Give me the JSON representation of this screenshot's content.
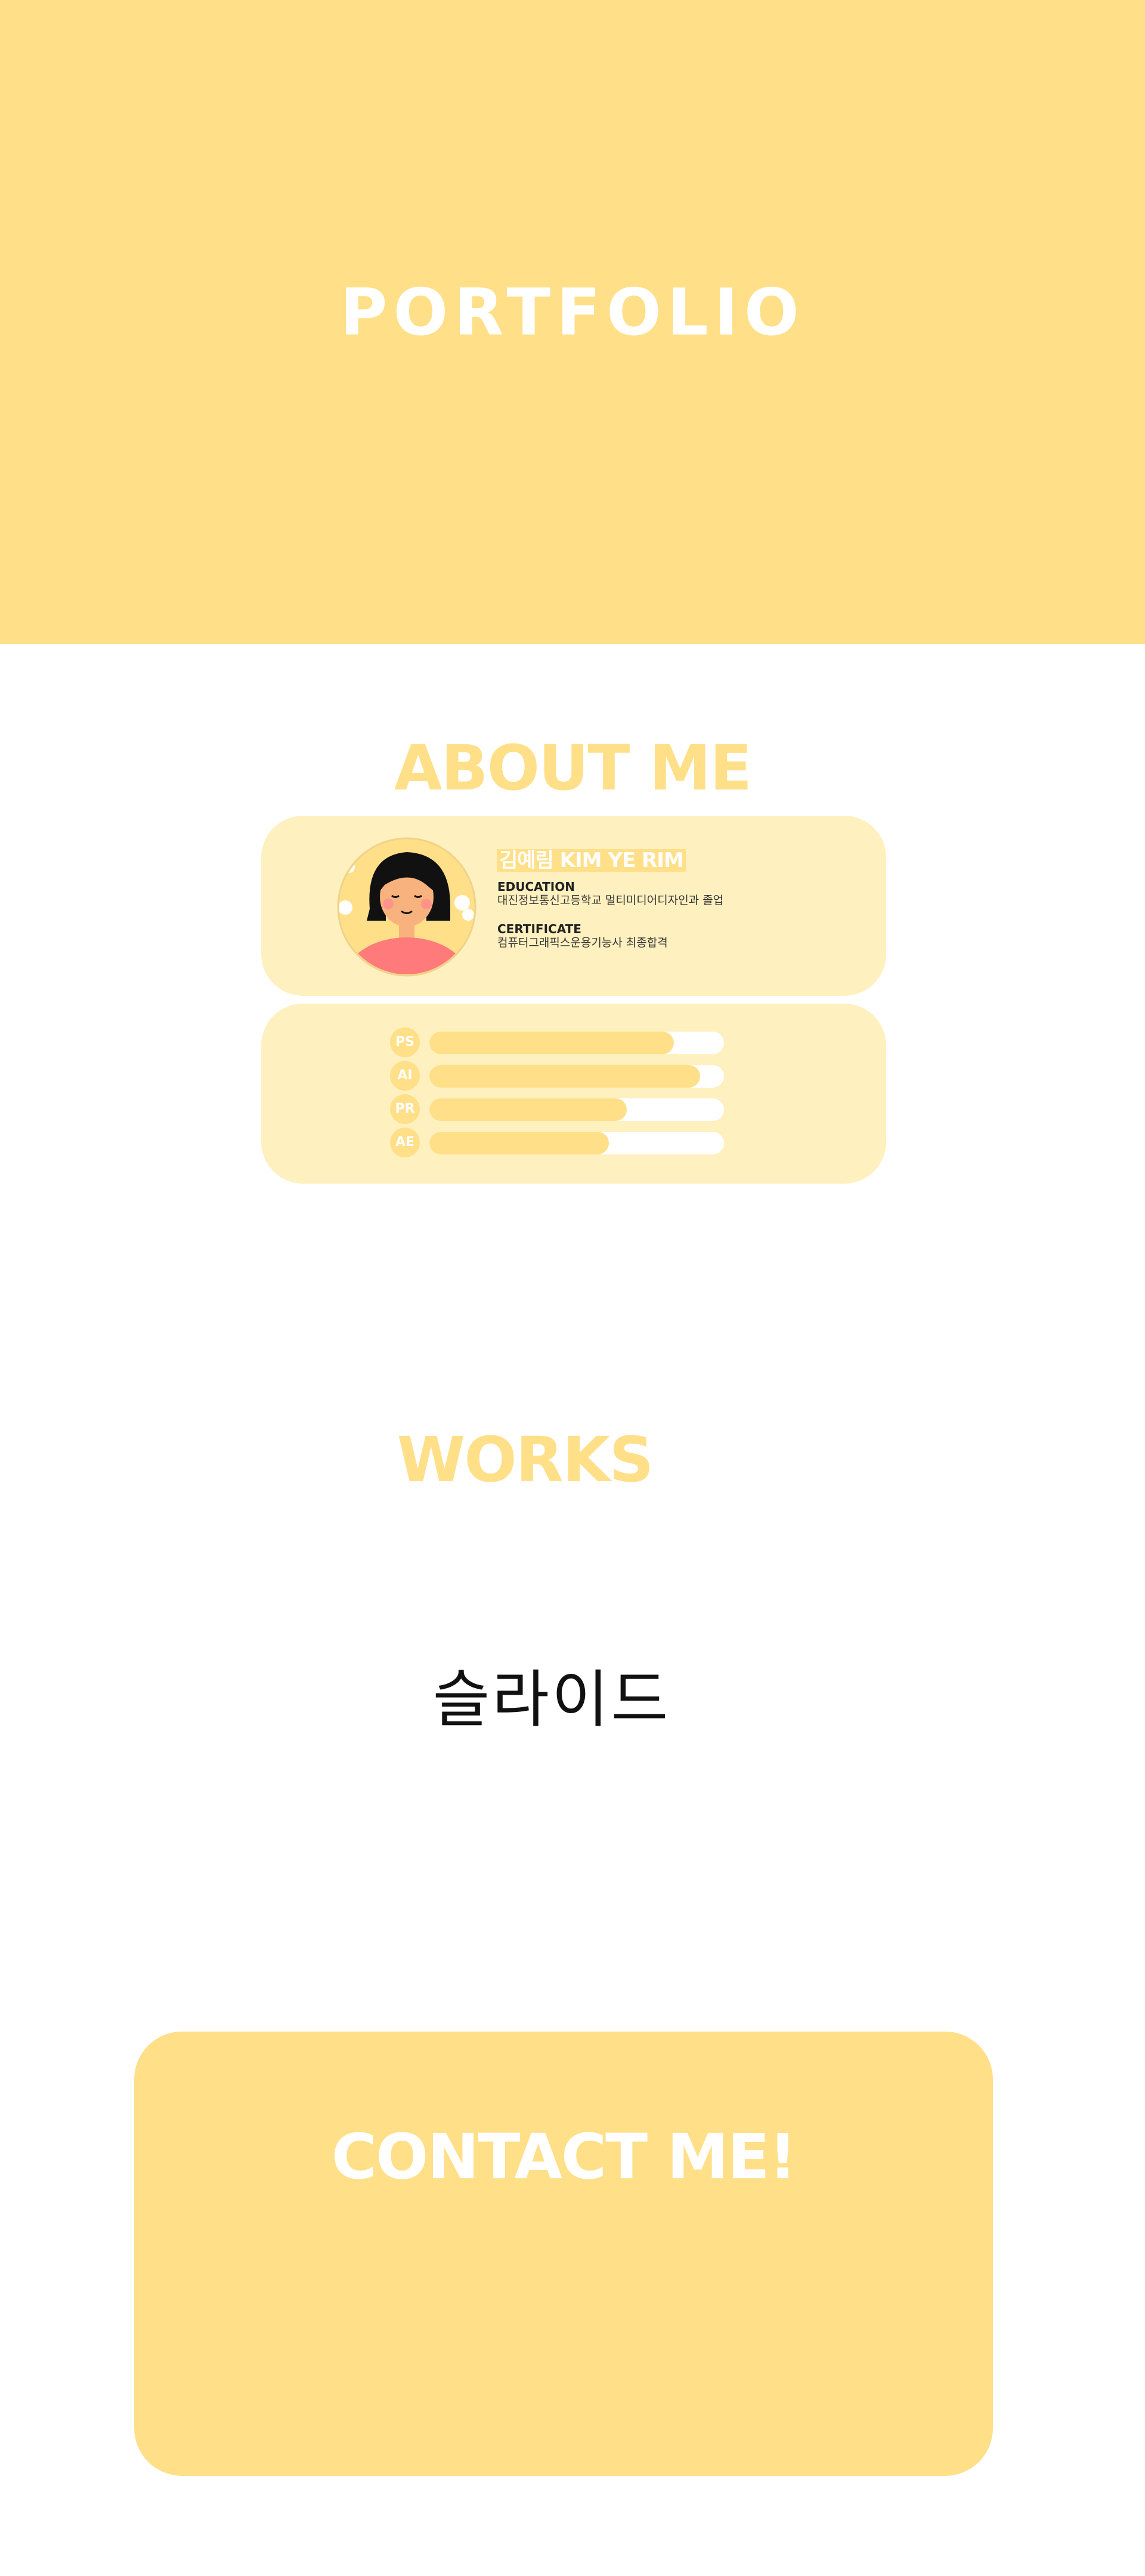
{
  "hero": {
    "title": "PORTFOLIO"
  },
  "about": {
    "heading": "ABOUT ME",
    "name": "김예림 KIM YE RIM",
    "education_label": "EDUCATION",
    "education_value": "대진정보통신고등학교 멀티미디어디자인과 졸업",
    "certificate_label": "CERTIFICATE",
    "certificate_value": "컴퓨터그래픽스운용기능사 최종합격",
    "skills": [
      {
        "label": "PS",
        "level": 0.83
      },
      {
        "label": "AI",
        "level": 0.92
      },
      {
        "label": "PR",
        "level": 0.67
      },
      {
        "label": "AE",
        "level": 0.61
      }
    ]
  },
  "works": {
    "heading": "WORKS",
    "slide_placeholder": "슬라이드"
  },
  "contact": {
    "title": "CONTACT ME!"
  },
  "colors": {
    "accent": "#ffdf88",
    "card": "#fff0bf",
    "skin": "#f7b27e",
    "shirt": "#ff7a7a"
  }
}
